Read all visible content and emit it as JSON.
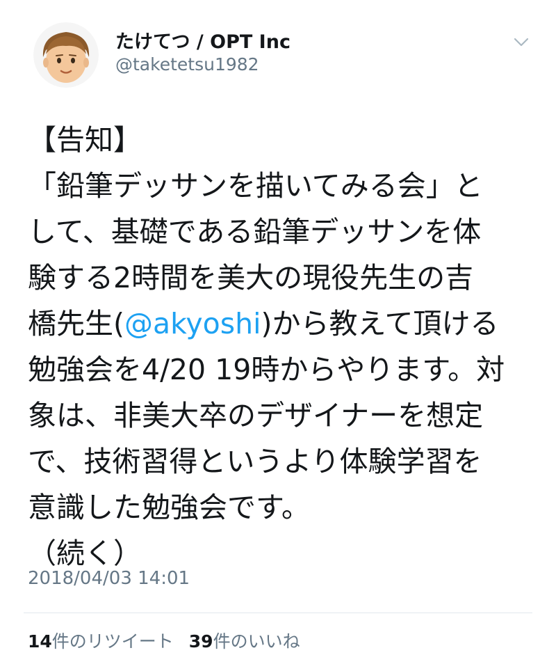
{
  "tweet": {
    "display_name": "たけてつ / OPT Inc",
    "handle": "@taketetsu1982",
    "lines": [
      {
        "a": "【告知】"
      },
      {
        "a": "「鉛筆デッサンを描いてみる会」と"
      },
      {
        "a": "して、基礎である鉛筆デッサンを体"
      },
      {
        "a": "験する2時間を美大の現役先生の吉"
      },
      {
        "a": "橋先生(",
        "mention": "@akyoshi",
        "b": ")から教えて頂ける"
      },
      {
        "a": "勉強会を4/20 19時からやります。対"
      },
      {
        "a": "象は、非美大卒のデザイナーを想定"
      },
      {
        "a": "で、技術習得というより体験学習を"
      },
      {
        "a": "意識した勉強会です。"
      },
      {
        "a": "（続く）"
      }
    ],
    "timestamp": "2018/04/03 14:01",
    "retweet_count": "14",
    "retweet_label": "件のリツイート",
    "like_count": "39",
    "like_label": "件のいいね"
  },
  "icons": {
    "avatar": "cartoon-face-avatar",
    "menu": "chevron-down-icon"
  },
  "colors": {
    "text": "#14171a",
    "secondary": "#657786",
    "link": "#1da1f2",
    "divider": "#e1e8ed"
  }
}
